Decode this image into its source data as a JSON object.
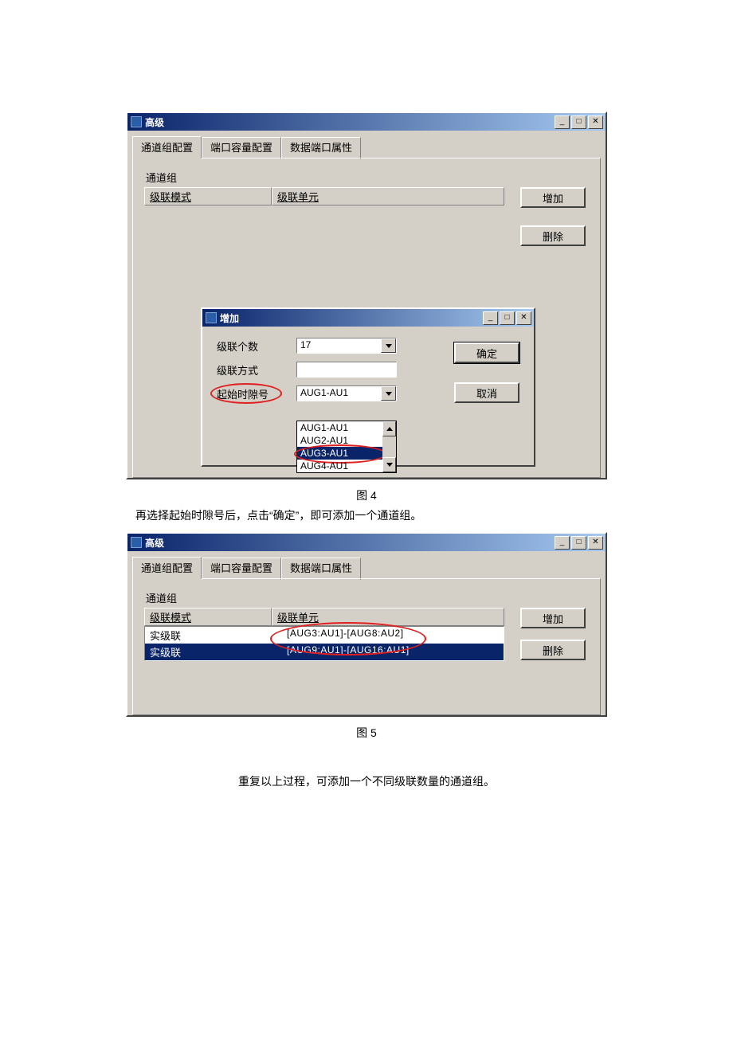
{
  "win1": {
    "title": "高级",
    "tabs": [
      "通道组配置",
      "端口容量配置",
      "数据端口属性"
    ],
    "group_label": "通道组",
    "columns": [
      "级联模式",
      "级联单元"
    ],
    "buttons": {
      "add": "增加",
      "delete": "删除"
    }
  },
  "dialog": {
    "title": "增加",
    "labels": {
      "count": "级联个数",
      "mode": "级联方式",
      "start": "起始时隙号"
    },
    "count_value": "17",
    "start_value": "AUG1-AU1",
    "options": [
      "AUG1-AU1",
      "AUG2-AU1",
      "AUG3-AU1",
      "AUG4-AU1"
    ],
    "selected_option_index": 2,
    "buttons": {
      "ok": "确定",
      "cancel": "取消"
    }
  },
  "caption1": "图 4",
  "text_between": "再选择起始时隙号后，点击“确定”，即可添加一个通道组。",
  "win2": {
    "title": "高级",
    "tabs": [
      "通道组配置",
      "端口容量配置",
      "数据端口属性"
    ],
    "group_label": "通道组",
    "columns": [
      "级联模式",
      "级联单元"
    ],
    "rows": [
      {
        "mode": "实级联",
        "unit": "[AUG3:AU1]-[AUG8:AU2]"
      },
      {
        "mode": "实级联",
        "unit": "[AUG9:AU1]-[AUG16:AU1]"
      }
    ],
    "buttons": {
      "add": "增加",
      "delete": "删除"
    }
  },
  "caption2": "图 5",
  "text_after": "重复以上过程，可添加一个不同级联数量的通道组。"
}
